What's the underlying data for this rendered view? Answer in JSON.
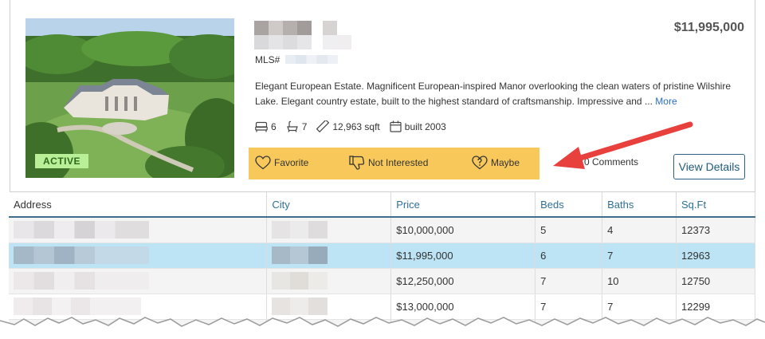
{
  "listing": {
    "status": "ACTIVE",
    "price": "$11,995,000",
    "mls_label": "MLS#",
    "description": "Elegant European Estate. Magnificent European-inspired Manor overlooking the clean waters of pristine Wilshire Lake. Elegant country estate, built to the highest standard of craftsmanship. Impressive and ...",
    "more_label": "More",
    "beds": "6",
    "baths": "7",
    "sqft": "12,963 sqft",
    "built": "built 2003",
    "actions": {
      "favorite": "Favorite",
      "not_interested": "Not Interested",
      "maybe": "Maybe"
    },
    "comments": "0 Comments",
    "view_details": "View Details"
  },
  "table": {
    "headers": {
      "address": "Address",
      "city": "City",
      "price": "Price",
      "beds": "Beds",
      "baths": "Baths",
      "sqft": "Sq.Ft"
    },
    "rows": [
      {
        "price": "$10,000,000",
        "beds": "5",
        "baths": "4",
        "sqft": "12373"
      },
      {
        "price": "$11,995,000",
        "beds": "6",
        "baths": "7",
        "sqft": "12963"
      },
      {
        "price": "$12,250,000",
        "beds": "7",
        "baths": "10",
        "sqft": "12750"
      },
      {
        "price": "$13,000,000",
        "beds": "7",
        "baths": "7",
        "sqft": "12299"
      }
    ]
  },
  "colors": {
    "action_bar": "#f8c95a",
    "selected_row": "#bde4f5",
    "link": "#2a6fbf",
    "arrow": "#e8413d"
  }
}
